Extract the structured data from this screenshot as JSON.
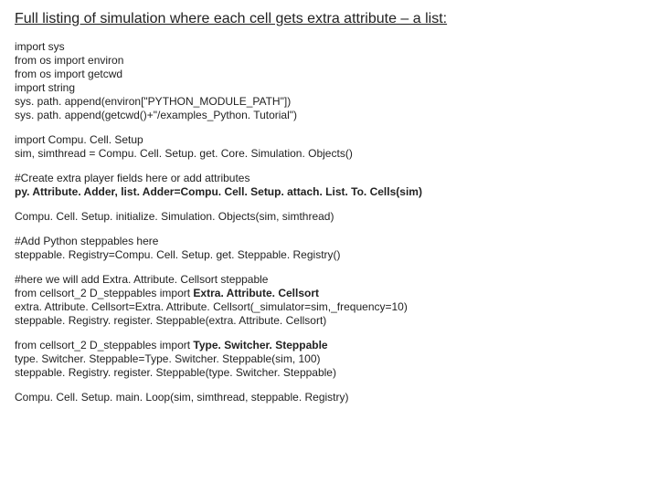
{
  "title": "Full listing of simulation where each cell gets extra attribute – a list:",
  "block1": {
    "l1": "import sys",
    "l2": "from os import environ",
    "l3": "from os import getcwd",
    "l4": "import string",
    "l5": "sys. path. append(environ[\"PYTHON_MODULE_PATH\"])",
    "l6": "sys. path. append(getcwd()+\"/examples_Python. Tutorial\")"
  },
  "block2": {
    "l1": "import Compu. Cell. Setup",
    "l2": "sim, simthread = Compu. Cell. Setup. get. Core. Simulation. Objects()"
  },
  "block3": {
    "l1": "#Create extra player fields here or add attributes",
    "l2": "py. Attribute. Adder, list. Adder=Compu. Cell. Setup. attach. List. To. Cells(sim)"
  },
  "block4": {
    "l1": "Compu. Cell. Setup. initialize. Simulation. Objects(sim, simthread)"
  },
  "block5": {
    "l1": "#Add Python steppables here",
    "l2": "steppable. Registry=Compu. Cell. Setup. get. Steppable. Registry()"
  },
  "block6": {
    "l1": "#here we will add Extra. Attribute. Cellsort steppable",
    "l2a": "from cellsort_2 D_steppables import ",
    "l2b": "Extra. Attribute. Cellsort",
    "l3": "extra. Attribute. Cellsort=Extra. Attribute. Cellsort(_simulator=sim,_frequency=10)",
    "l4": "steppable. Registry. register. Steppable(extra. Attribute. Cellsort)"
  },
  "block7": {
    "l1a": "from cellsort_2 D_steppables import ",
    "l1b": "Type. Switcher. Steppable",
    "l2": "type. Switcher. Steppable=Type. Switcher. Steppable(sim, 100)",
    "l3": "steppable. Registry. register. Steppable(type. Switcher. Steppable)"
  },
  "block8": {
    "l1": "Compu. Cell. Setup. main. Loop(sim, simthread, steppable. Registry)"
  }
}
